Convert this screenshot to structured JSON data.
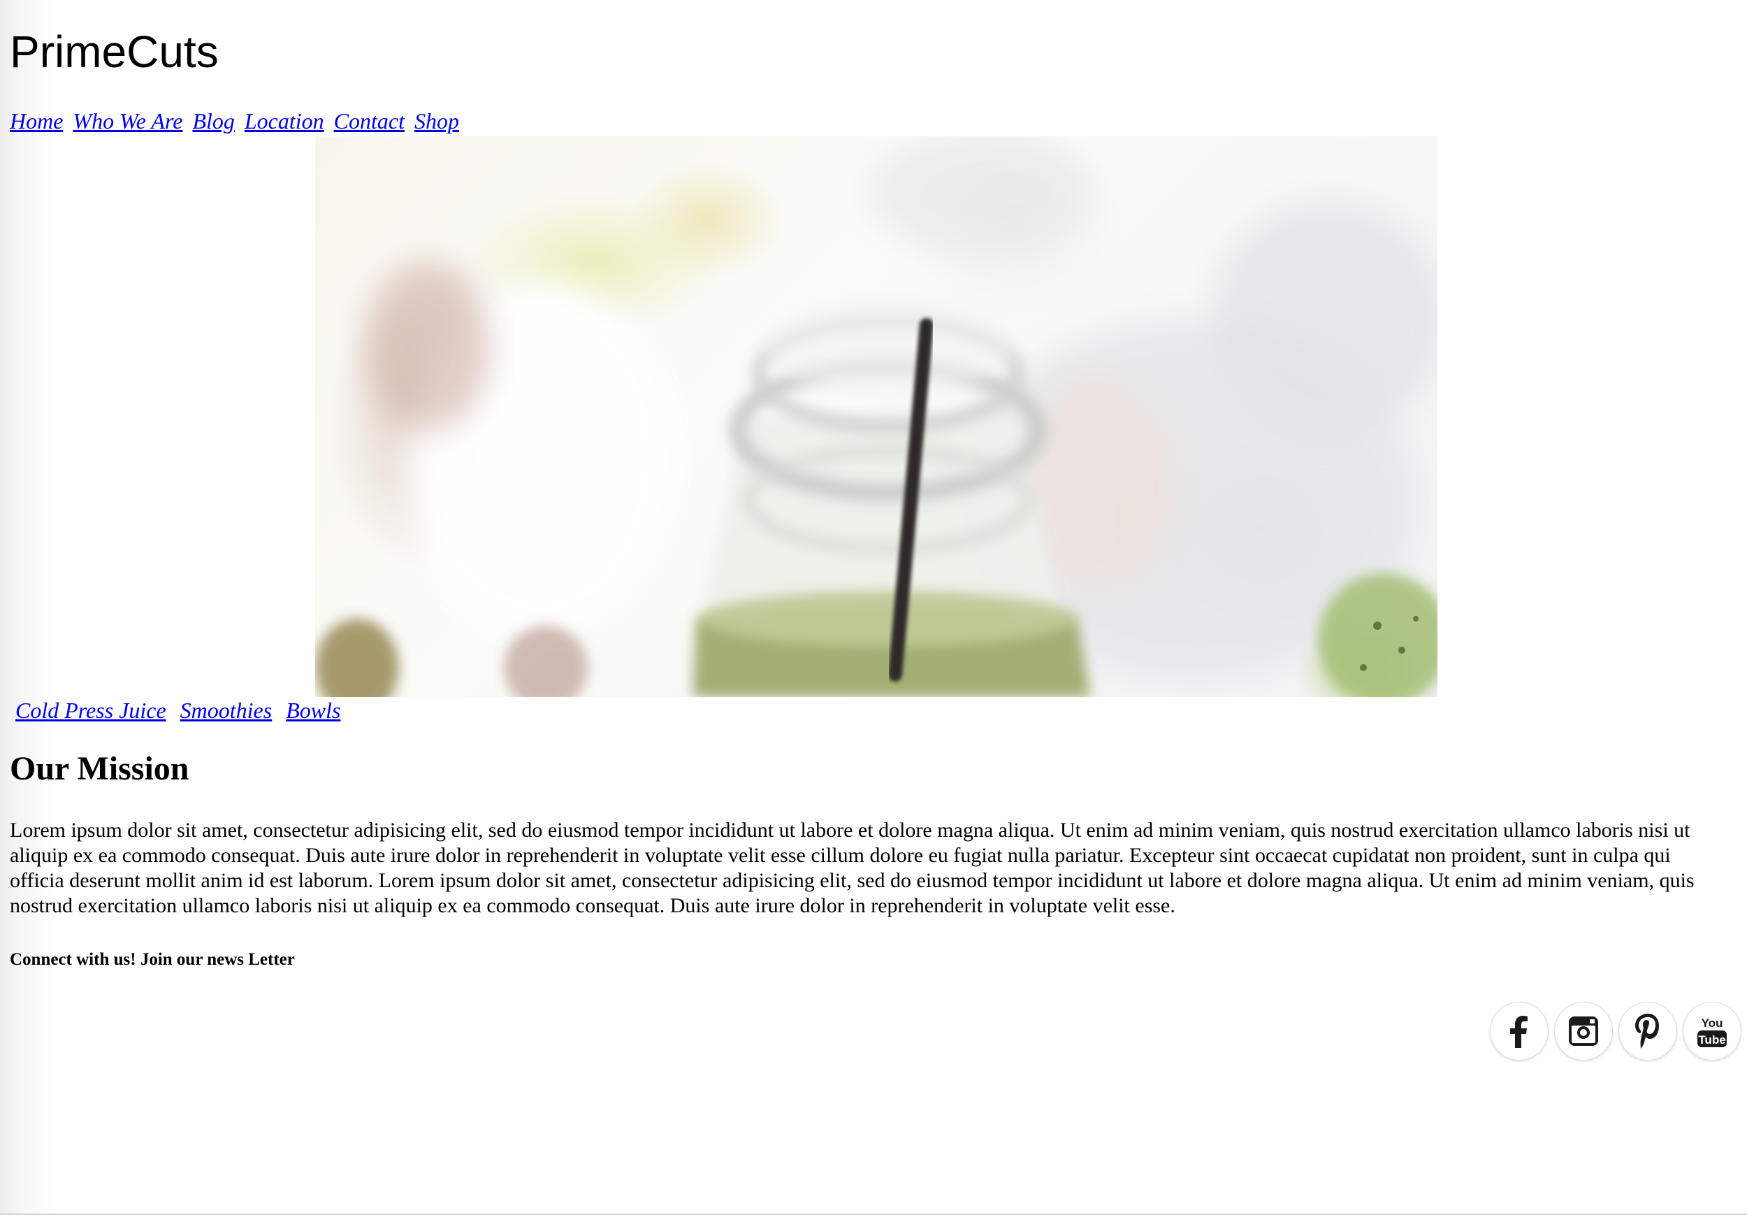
{
  "site": {
    "brand": "PrimeCuts"
  },
  "main_nav": [
    {
      "label": "Home"
    },
    {
      "label": "Who We Are"
    },
    {
      "label": "Blog"
    },
    {
      "label": "Location"
    },
    {
      "label": "Contact"
    },
    {
      "label": "Shop"
    }
  ],
  "hero": {
    "icon": "blurred-juice-bottle-photo"
  },
  "sub_nav": [
    {
      "label": "Cold Press Juice"
    },
    {
      "label": "Smoothies"
    },
    {
      "label": "Bowls"
    }
  ],
  "mission": {
    "title": "Our Mission",
    "body": "Lorem ipsum dolor sit amet, consectetur adipisicing elit, sed do eiusmod tempor incididunt ut labore et dolore magna aliqua. Ut enim ad minim veniam, quis nostrud exercitation ullamco laboris nisi ut aliquip ex ea commodo consequat. Duis aute irure dolor in reprehenderit in voluptate velit esse cillum dolore eu fugiat nulla pariatur. Excepteur sint occaecat cupidatat non proident, sunt in culpa qui officia deserunt mollit anim id est laborum. Lorem ipsum dolor sit amet, consectetur adipisicing elit, sed do eiusmod tempor incididunt ut labore et dolore magna aliqua. Ut enim ad minim veniam, quis nostrud exercitation ullamco laboris nisi ut aliquip ex ea commodo consequat. Duis aute irure dolor in reprehenderit in voluptate velit esse."
  },
  "newsletter": {
    "text": "Connect with us! Join our news Letter"
  },
  "social": [
    {
      "icon": "facebook-icon"
    },
    {
      "icon": "instagram-icon"
    },
    {
      "icon": "pinterest-icon"
    },
    {
      "icon": "youtube-icon",
      "text_top": "You",
      "text_bottom": "Tube"
    }
  ]
}
